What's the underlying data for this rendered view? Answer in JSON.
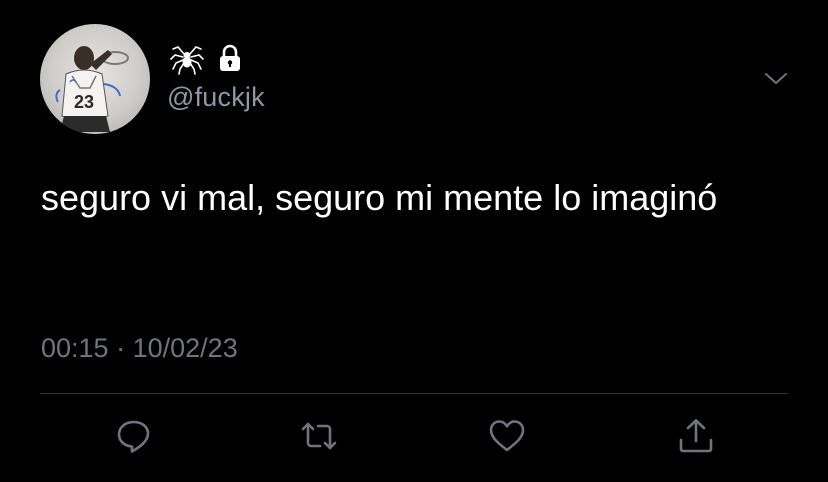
{
  "tweet": {
    "handle": "@fuckjk",
    "text": "seguro vi mal, seguro mi mente lo imaginó",
    "time": "00:15",
    "separator": "·",
    "date": "10/02/23",
    "display_name_icons": [
      "spider-icon",
      "lock-icon"
    ],
    "avatar_jersey_number": "23"
  },
  "actions": [
    "reply-icon",
    "retweet-icon",
    "like-icon",
    "share-icon"
  ],
  "colors": {
    "background": "#000000",
    "text": "#ffffff",
    "handle": "#8b98a5",
    "meta": "#6e767d",
    "divider": "#2f3336"
  }
}
